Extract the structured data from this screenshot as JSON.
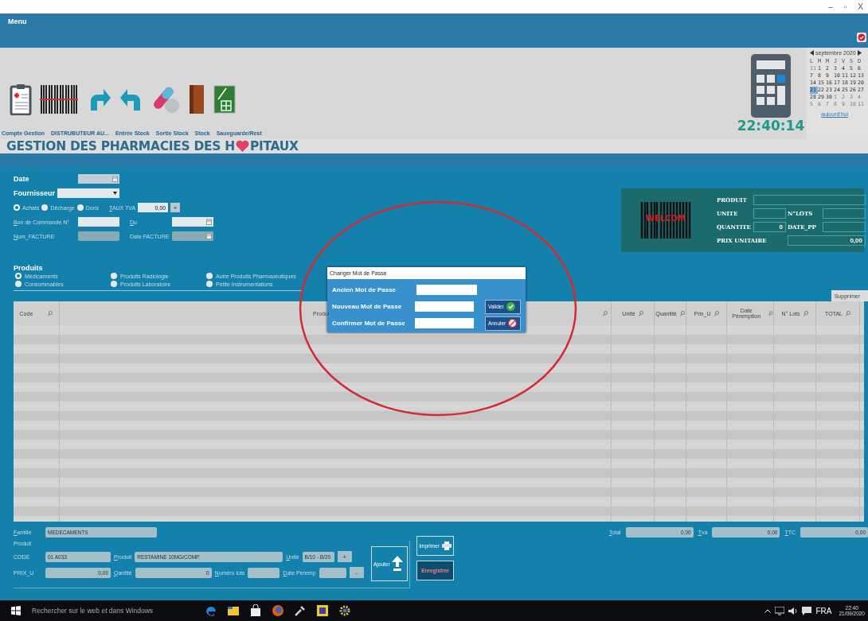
{
  "window": {
    "controls": [
      "–",
      "▫",
      "X"
    ]
  },
  "menu": {
    "label": "Menu"
  },
  "toolbar": {
    "icons": [
      {
        "kind": "clipboard"
      },
      {
        "kind": "barcode"
      },
      {
        "kind": "redo"
      },
      {
        "kind": "undo"
      },
      {
        "kind": "pills"
      },
      {
        "kind": "binder"
      },
      {
        "kind": "spreadsheet"
      }
    ],
    "labels": [
      "Compte Gestion",
      "DISTRUBUTEUR AU...",
      "Entrée Stock",
      "Sortie Stock",
      "Stock",
      "Sauvguarde/Rest"
    ]
  },
  "clock": "22:40:14",
  "calendar": {
    "month": "septembre 2020",
    "weekdays": [
      "L",
      "M",
      "M",
      "J",
      "V",
      "S",
      "D"
    ],
    "weeks": [
      [
        {
          "d": "31",
          "outside": true,
          "selected": false
        },
        {
          "d": "1",
          "outside": false,
          "selected": false
        },
        {
          "d": "2",
          "outside": false,
          "selected": false
        },
        {
          "d": "3",
          "outside": false,
          "selected": false
        },
        {
          "d": "4",
          "outside": false,
          "selected": false
        },
        {
          "d": "5",
          "outside": false,
          "selected": false
        },
        {
          "d": "6",
          "outside": false,
          "selected": false
        }
      ],
      [
        {
          "d": "7",
          "outside": false,
          "selected": false
        },
        {
          "d": "8",
          "outside": false,
          "selected": false
        },
        {
          "d": "9",
          "outside": false,
          "selected": false
        },
        {
          "d": "10",
          "outside": false,
          "selected": false
        },
        {
          "d": "11",
          "outside": false,
          "selected": false
        },
        {
          "d": "12",
          "outside": false,
          "selected": false
        },
        {
          "d": "13",
          "outside": false,
          "selected": false
        }
      ],
      [
        {
          "d": "14",
          "outside": false,
          "selected": false
        },
        {
          "d": "15",
          "outside": false,
          "selected": false
        },
        {
          "d": "16",
          "outside": false,
          "selected": false
        },
        {
          "d": "17",
          "outside": false,
          "selected": false
        },
        {
          "d": "18",
          "outside": false,
          "selected": false
        },
        {
          "d": "19",
          "outside": false,
          "selected": false
        },
        {
          "d": "20",
          "outside": false,
          "selected": false
        }
      ],
      [
        {
          "d": "21",
          "outside": false,
          "selected": true
        },
        {
          "d": "22",
          "outside": false,
          "selected": false
        },
        {
          "d": "23",
          "outside": false,
          "selected": false
        },
        {
          "d": "24",
          "outside": false,
          "selected": false
        },
        {
          "d": "25",
          "outside": false,
          "selected": false
        },
        {
          "d": "26",
          "outside": false,
          "selected": false
        },
        {
          "d": "27",
          "outside": false,
          "selected": false
        }
      ],
      [
        {
          "d": "28",
          "outside": false,
          "selected": false
        },
        {
          "d": "29",
          "outside": false,
          "selected": false
        },
        {
          "d": "30",
          "outside": false,
          "selected": false
        },
        {
          "d": "1",
          "outside": true,
          "selected": false
        },
        {
          "d": "2",
          "outside": true,
          "selected": false
        },
        {
          "d": "3",
          "outside": true,
          "selected": false
        },
        {
          "d": "4",
          "outside": true,
          "selected": false
        }
      ],
      [
        {
          "d": "5",
          "outside": true,
          "selected": false
        },
        {
          "d": "6",
          "outside": true,
          "selected": false
        },
        {
          "d": "7",
          "outside": true,
          "selected": false
        },
        {
          "d": "8",
          "outside": true,
          "selected": false
        },
        {
          "d": "9",
          "outside": true,
          "selected": false
        },
        {
          "d": "10",
          "outside": true,
          "selected": false
        },
        {
          "d": "11",
          "outside": true,
          "selected": false
        }
      ]
    ],
    "today_link": "aujourd'hui"
  },
  "title": {
    "before": "GESTION DES PHARMACIES DES H",
    "after": "PITAUX"
  },
  "form": {
    "date_label": "Date",
    "supplier_label": "Fournisseur",
    "operation_types": [
      {
        "label": "Achats",
        "selected": true
      },
      {
        "label": "Décharge",
        "selected": false
      },
      {
        "label": "Dons",
        "selected": false
      }
    ],
    "tva": {
      "label": "TAUX TVA",
      "value": "0,00",
      "button": "+"
    },
    "order_label": "Bon de Commande N°",
    "from_label": "Du",
    "invoice_label": "Num_FACTURE",
    "invoice_date_label": "Date FACTURE"
  },
  "products": {
    "label": "Produits",
    "categories": [
      {
        "label": "Médicaments",
        "selected": true
      },
      {
        "label": "Produits Radiologie",
        "selected": false
      },
      {
        "label": "Autre Produits Pharmaceutiques",
        "selected": false
      },
      {
        "label": "Consommables",
        "selected": false
      },
      {
        "label": "Produits Laboratoire",
        "selected": false
      },
      {
        "label": "Petite Instrumentations",
        "selected": false
      }
    ]
  },
  "scan_panel": {
    "product_label": "PRODUIT",
    "unit_label": "UNITE",
    "lots_label": "N°LOTS",
    "quantity_label": "QUANTITE",
    "quantity": "0",
    "date_label": "DATE_PP",
    "price_label": "PRIX UNITAIRE",
    "price": "0,00",
    "barcode_text": "WELCOM"
  },
  "delete_button": "Supprimer",
  "table": {
    "columns": [
      "Code",
      "Produi",
      "Unité",
      "Quantité",
      "Prix_U",
      "Date Péremption",
      "N° Lots",
      "TOTAL"
    ]
  },
  "dialog": {
    "title": "Changer Mot de Passe",
    "fields": [
      "Ancien Mot de Passe",
      "Nouveau Mot de Passe",
      "Confirmer  Mot de Passe"
    ],
    "ok": "Valider",
    "cancel": "Annuler"
  },
  "bottom": {
    "family_label": "Famille",
    "family": "MEDECAMENTS",
    "totals": [
      {
        "label": "Total",
        "value": "0,00"
      },
      {
        "label": "Tva",
        "value": "0,00"
      },
      {
        "label": "TTC",
        "value": "0,00"
      }
    ],
    "group_label": "Produit",
    "code_label": "CODE",
    "code": "01 A033",
    "product_label": "Produit",
    "product": "RESTAMINE  10MG/COMP.",
    "unit_label": "Unité",
    "unit": "B/10 - B/20",
    "plus": "+",
    "price_label": "PRIX_U",
    "price": "0,00",
    "qty_label": "Qantité",
    "qty": "0",
    "lot_label": "Numéro lots",
    "exp_label": "Date Peremp",
    "minus": "-",
    "add": "Ajouter",
    "print": "Imprimer",
    "save": "Enregistrer"
  },
  "taskbar": {
    "search": "Rechercher sur le web et dans Windows",
    "apps": [
      {
        "kind": "edge"
      },
      {
        "kind": "files"
      },
      {
        "kind": "store"
      },
      {
        "kind": "firefox"
      },
      {
        "kind": "tool"
      },
      {
        "kind": "calendar"
      },
      {
        "kind": "gear"
      }
    ],
    "language": "FRA",
    "time": "22:40",
    "date": "21/09/2020"
  }
}
